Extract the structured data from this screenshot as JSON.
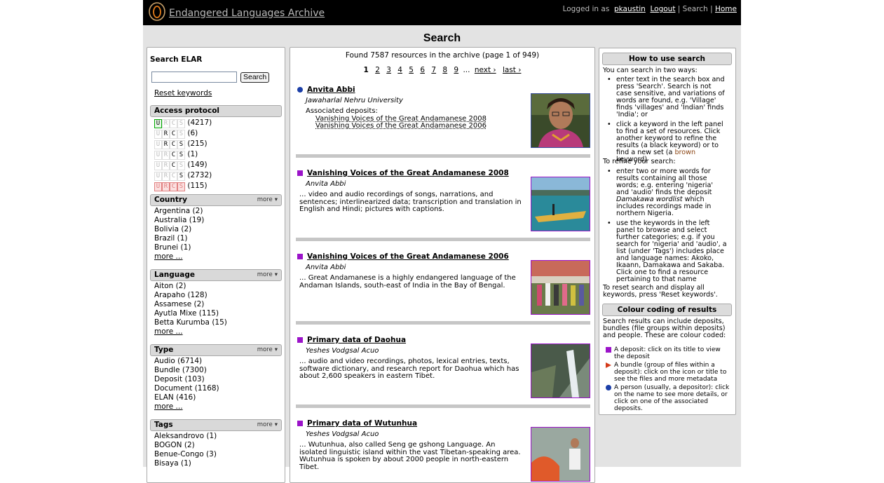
{
  "header": {
    "site_title": "Endangered Languages Archive",
    "logged_in_as": "Logged in as",
    "username": "pkaustin",
    "logout": "Logout",
    "search": "Search",
    "home": "Home",
    "sep": "|"
  },
  "page_title": "Search",
  "left": {
    "title": "Search ELAR",
    "search_placeholder": "",
    "search_button": "Search",
    "reset": "Reset keywords",
    "access": {
      "label": "Access protocol",
      "items": [
        {
          "flags": "U",
          "count": "(4217)"
        },
        {
          "flags": "RC",
          "count": "(6)"
        },
        {
          "flags": "RCS",
          "count": "(215)"
        },
        {
          "flags": "CS",
          "count": "(1)"
        },
        {
          "flags": "C",
          "count": "(149)"
        },
        {
          "flags": "S",
          "count": "(2732)"
        },
        {
          "flags": "none",
          "count": "(115)"
        }
      ]
    },
    "more_label": "more",
    "more_link": "more ...",
    "country": {
      "label": "Country",
      "items": [
        "Argentina (2)",
        "Australia (19)",
        "Bolivia (2)",
        "Brazil (1)",
        "Brunei (1)"
      ]
    },
    "language": {
      "label": "Language",
      "items": [
        "Aiton (2)",
        "Arapaho (128)",
        "Assamese (2)",
        "Ayutla Mixe (115)",
        "Betta Kurumba (15)"
      ]
    },
    "type": {
      "label": "Type",
      "items": [
        "Audio (6714)",
        "Bundle (7300)",
        "Deposit (103)",
        "Document (1168)",
        "ELAN (416)"
      ]
    },
    "tags": {
      "label": "Tags",
      "items": [
        "Aleksandrovo (1)",
        "BOGON (2)",
        "Benue-Congo (3)",
        "Bisaya (1)"
      ]
    }
  },
  "center": {
    "found": "Found 7587 resources in the archive (page 1 of 949)",
    "pager": {
      "current": "1",
      "pages": [
        "2",
        "3",
        "4",
        "5",
        "6",
        "7",
        "8",
        "9"
      ],
      "ellipsis": "...",
      "next": "next ›",
      "last": "last ›"
    },
    "results": [
      {
        "kind": "person",
        "title": "Anvita Abbi",
        "sub": "Jawaharlal Nehru University",
        "assoc_label": "Associated deposits:",
        "assoc": [
          "Vanishing Voices of the Great Andamanese 2008",
          "Vanishing Voices of the Great Andamanese 2006"
        ]
      },
      {
        "kind": "deposit",
        "title": "Vanishing Voices of the Great Andamanese 2008",
        "sub": "Anvita Abbi",
        "desc": "... video and audio recordings of songs, narrations, and sentences; interlinearized data; transcription and translation in English and Hindi; pictures with captions."
      },
      {
        "kind": "deposit",
        "title": "Vanishing Voices of the Great Andamanese 2006",
        "sub": "Anvita Abbi",
        "desc": "... Great Andamanese is a highly endangered language of the Andaman Islands, south-east of India in the Bay of Bengal."
      },
      {
        "kind": "deposit",
        "title": "Primary data of Daohua",
        "sub": "Yeshes Vodgsal Acuo",
        "desc": "... audio and video recordings, photos, lexical entries, texts, software dictionary, and research report for Daohua which has about 2,600 speakers in eastern Tibet."
      },
      {
        "kind": "deposit",
        "title": "Primary data of Wutunhua",
        "sub": "Yeshes Vodgsal Acuo",
        "desc": "... Wutunhua, also called Seng ge gshong Language. An isolated linguistic island within the vast Tibetan-speaking area. Wutunhua is spoken by about 2000 people in north-eastern Tibet."
      }
    ]
  },
  "right": {
    "how_title": "How to use search",
    "intro": "You can search in two ways:",
    "ways": [
      "enter text in the search box and press 'Search'. Search is not case sensitive, and variations of words are found, e.g. 'Village' finds 'villages' and 'Indian' finds 'India'; or",
      "click a keyword in the left panel to find a set of resources. Click another keyword to refine the results (a black keyword) or to find a new set (a"
    ],
    "brown_word": "brown",
    "keyword_suffix": "keyword)",
    "refine_intro": "To refine your search:",
    "refine": [
      "enter two or more words for results containing all those words; e.g. entering 'nigeria' and 'audio' finds the deposit",
      "use the keywords in the left panel to browse and select further categories; e.g. if you search for 'nigeria' and 'audio', a list (under 'Tags') includes place and language names: Akoko, Ikaann, Damakawa and Sakaba. Click one to find a resource pertaining to that name"
    ],
    "deposit_name": "Damakawa wordlist",
    "deposit_suffix": "which includes recordings made in northern Nigeria.",
    "reset_text": "To reset search and display all keywords, press 'Reset keywords'.",
    "colour_title": "Colour coding of results",
    "colour_intro": "Search results can include deposits, bundles (file groups within deposits) and people. These are colour coded:",
    "legend": [
      {
        "color": "#9b13c9",
        "text": "A deposit: click on its title to view the deposit"
      },
      {
        "color": "#d43a1a",
        "text": "A bundle (group of files within a deposit): click on the icon or title to see the files and more metadata"
      },
      {
        "color": "#1c3fa8",
        "text": "A person (usually, a depositor): click on the name to see more details, or click on one of the associated deposits."
      }
    ]
  }
}
